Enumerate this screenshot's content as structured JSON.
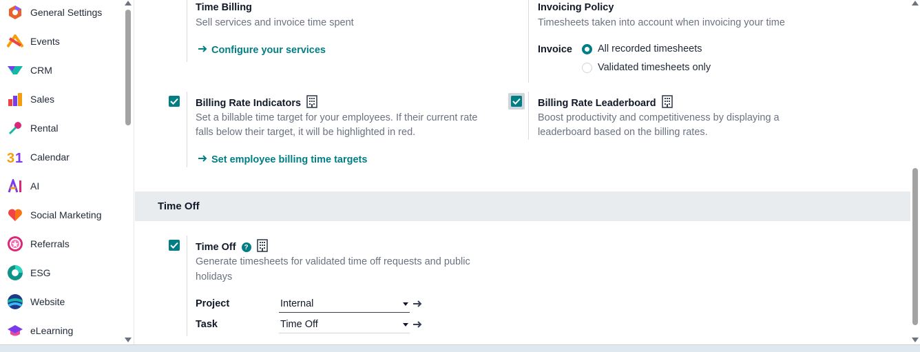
{
  "sidebar": {
    "items": [
      {
        "label": "General Settings",
        "icon": "general-settings-icon"
      },
      {
        "label": "Events",
        "icon": "events-icon"
      },
      {
        "label": "CRM",
        "icon": "crm-icon"
      },
      {
        "label": "Sales",
        "icon": "sales-icon"
      },
      {
        "label": "Rental",
        "icon": "rental-icon"
      },
      {
        "label": "Calendar",
        "icon": "calendar-icon"
      },
      {
        "label": "AI",
        "icon": "ai-icon"
      },
      {
        "label": "Social Marketing",
        "icon": "social-marketing-icon"
      },
      {
        "label": "Referrals",
        "icon": "referrals-icon"
      },
      {
        "label": "ESG",
        "icon": "esg-icon"
      },
      {
        "label": "Website",
        "icon": "website-icon"
      },
      {
        "label": "eLearning",
        "icon": "elearning-icon"
      }
    ]
  },
  "time_billing": {
    "title": "Time Billing",
    "desc": "Sell services and invoice time spent",
    "link": "Configure your services"
  },
  "invoicing_policy": {
    "title": "Invoicing Policy",
    "desc": "Timesheets taken into account when invoicing your time",
    "invoice_label": "Invoice",
    "options": [
      "All recorded timesheets",
      "Validated timesheets only"
    ],
    "selected": "All recorded timesheets"
  },
  "billing_rate_indicators": {
    "title": "Billing Rate Indicators",
    "checked": true,
    "desc_line1": "Set a billable time target for your employees. If their current rate",
    "desc_line2": "falls below their target, it will be highlighted in red.",
    "link": "Set employee billing time targets"
  },
  "billing_rate_leaderboard": {
    "title": "Billing Rate Leaderboard",
    "checked": true,
    "desc_line1": "Boost productivity and competitiveness by displaying a",
    "desc_line2": "leaderboard based on the billing rates."
  },
  "time_off_section": {
    "heading": "Time Off"
  },
  "time_off": {
    "title": "Time Off",
    "checked": true,
    "desc_line1": "Generate timesheets for validated time off requests and public",
    "desc_line2": "holidays",
    "project_label": "Project",
    "project_value": "Internal",
    "task_label": "Task",
    "task_value": "Time Off"
  },
  "colors": {
    "accent": "#017e84",
    "section_bg": "#e9ecef"
  }
}
